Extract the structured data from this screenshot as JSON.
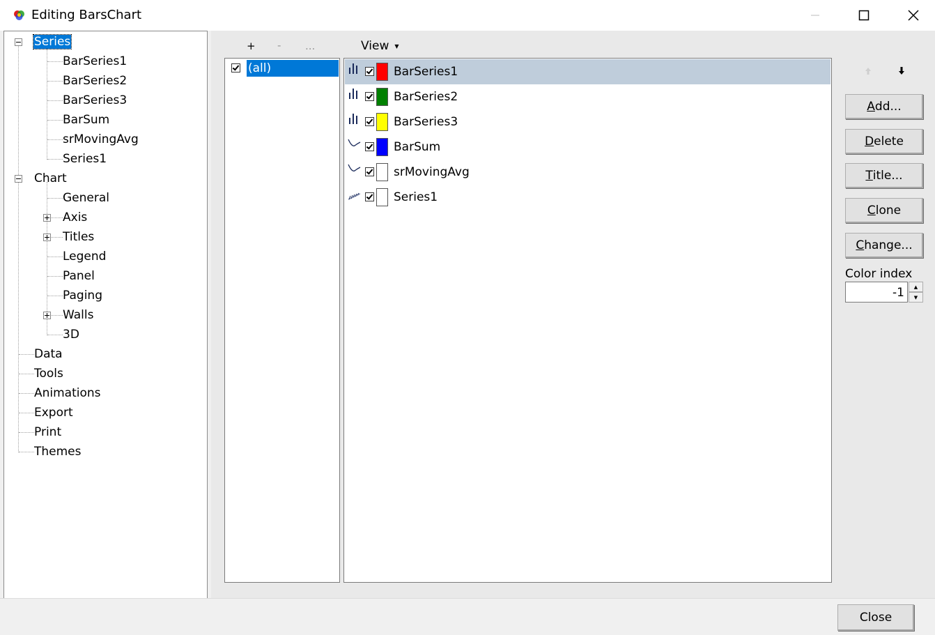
{
  "window": {
    "title": "Editing BarsChart",
    "minimize_icon": "minimize-icon",
    "maximize_icon": "maximize-icon",
    "close_icon": "close-icon"
  },
  "tree": {
    "series": {
      "label": "Series",
      "children": [
        "BarSeries1",
        "BarSeries2",
        "BarSeries3",
        "BarSum",
        "srMovingAvg",
        "Series1"
      ]
    },
    "chart": {
      "label": "Chart",
      "children": [
        "General",
        "Axis",
        "Titles",
        "Legend",
        "Panel",
        "Paging",
        "Walls",
        "3D"
      ]
    },
    "other": [
      "Data",
      "Tools",
      "Animations",
      "Export",
      "Print",
      "Themes"
    ]
  },
  "toolbar": {
    "add": "+",
    "remove": "-",
    "more": "...",
    "view": "View"
  },
  "groups": {
    "items": [
      {
        "label": "(all)",
        "checked": true
      }
    ]
  },
  "series_list": [
    {
      "name": "BarSeries1",
      "icon": "bar-series-icon",
      "checked": true,
      "color": "#ff0000",
      "selected": true
    },
    {
      "name": "BarSeries2",
      "icon": "bar-series-icon",
      "checked": true,
      "color": "#008000",
      "selected": false
    },
    {
      "name": "BarSeries3",
      "icon": "bar-series-icon",
      "checked": true,
      "color": "#ffff00",
      "selected": false
    },
    {
      "name": "BarSum",
      "icon": "line-series-icon",
      "checked": true,
      "color": "#0000ff",
      "selected": false
    },
    {
      "name": "srMovingAvg",
      "icon": "line-series-icon",
      "checked": true,
      "color": "#ffffff",
      "selected": false
    },
    {
      "name": "Series1",
      "icon": "area-series-icon",
      "checked": true,
      "color": "#ffffff",
      "selected": false
    }
  ],
  "buttons": {
    "move_up_icon": "arrow-up-icon",
    "move_down_icon": "arrow-down-icon",
    "add": {
      "accel": "A",
      "rest": "dd..."
    },
    "delete": {
      "accel": "D",
      "rest": "elete"
    },
    "title": {
      "accel": "T",
      "rest": "itle..."
    },
    "clone": {
      "accel": "C",
      "rest": "lone"
    },
    "change": {
      "accel": "C",
      "rest": "hange..."
    }
  },
  "color_index": {
    "label": "Color index",
    "value": "-1"
  },
  "footer": {
    "close": "Close"
  },
  "colors": {
    "selection": "#0078d7",
    "row_highlight": "#bfcddb"
  }
}
